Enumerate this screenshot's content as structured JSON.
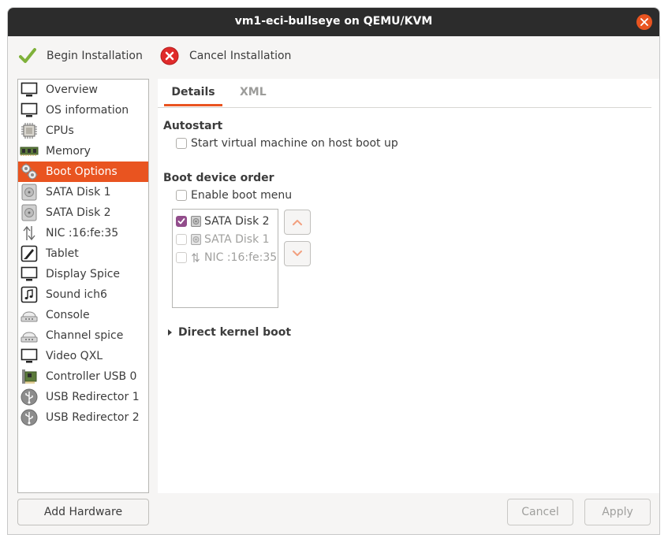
{
  "window": {
    "title": "vm1-eci-bullseye on QEMU/KVM"
  },
  "toolbar": {
    "begin_label": "Begin Installation",
    "cancel_label": "Cancel Installation"
  },
  "sidebar": {
    "items": [
      {
        "label": "Overview",
        "icon": "monitor-icon"
      },
      {
        "label": "OS information",
        "icon": "monitor-icon"
      },
      {
        "label": "CPUs",
        "icon": "cpu-icon"
      },
      {
        "label": "Memory",
        "icon": "memory-icon"
      },
      {
        "label": "Boot Options",
        "icon": "gears-icon"
      },
      {
        "label": "SATA Disk 1",
        "icon": "disk-icon"
      },
      {
        "label": "SATA Disk 2",
        "icon": "disk-icon"
      },
      {
        "label": "NIC :16:fe:35",
        "icon": "network-icon"
      },
      {
        "label": "Tablet",
        "icon": "tablet-icon"
      },
      {
        "label": "Display Spice",
        "icon": "monitor-icon"
      },
      {
        "label": "Sound ich6",
        "icon": "sound-icon"
      },
      {
        "label": "Console",
        "icon": "serial-icon"
      },
      {
        "label": "Channel spice",
        "icon": "serial-icon"
      },
      {
        "label": "Video QXL",
        "icon": "monitor-icon"
      },
      {
        "label": "Controller USB 0",
        "icon": "pci-card-icon"
      },
      {
        "label": "USB Redirector 1",
        "icon": "usb-icon"
      },
      {
        "label": "USB Redirector 2",
        "icon": "usb-icon"
      }
    ],
    "selected_index": 4,
    "add_hardware_label": "Add Hardware"
  },
  "tabs": {
    "details": "Details",
    "xml": "XML"
  },
  "autostart": {
    "heading": "Autostart",
    "checkbox_label": "Start virtual machine on host boot up",
    "checked": false
  },
  "boot_order": {
    "heading": "Boot device order",
    "enable_menu_label": "Enable boot menu",
    "enable_menu_checked": false,
    "devices": [
      {
        "label": "SATA Disk 2",
        "checked": true,
        "enabled": true,
        "icon": "disk-icon"
      },
      {
        "label": "SATA Disk 1",
        "checked": false,
        "enabled": false,
        "icon": "disk-icon"
      },
      {
        "label": "NIC :16:fe:35",
        "checked": false,
        "enabled": false,
        "icon": "network-icon"
      }
    ]
  },
  "direct_kernel": {
    "label": "Direct kernel boot"
  },
  "buttons": {
    "cancel": "Cancel",
    "apply": "Apply"
  },
  "colors": {
    "accent": "#e95420",
    "titlebar": "#2c2c2c",
    "checkbox_checked": "#924d8b"
  }
}
